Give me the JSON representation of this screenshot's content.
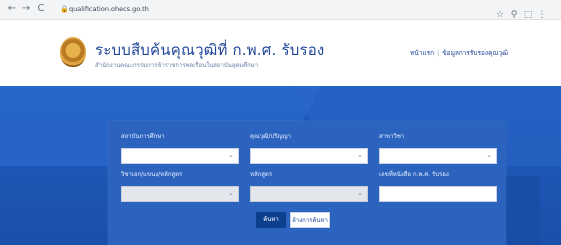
{
  "browser": {
    "back_icon": "←",
    "forward_icon": "→",
    "reload_icon": "C",
    "url": "qualification.ohecs.go.th",
    "toolbar_icons": [
      "star-icon",
      "search-icon",
      "extension-icon",
      "menu-icon"
    ]
  },
  "header": {
    "title": "ระบบสืบค้นคุณวุฒิที่ ก.พ.ศ. รับรอง",
    "subtitle": "สำนักงานคณะกรรมการข้าราชการพลเรือนในสถาบันอุดมศึกษา",
    "links": [
      "หน้าแรก",
      "ข้อมูลการรับรองคุณวุฒิ"
    ]
  },
  "search_form": {
    "fields": [
      {
        "label": "สถาบันการศึกษา",
        "type": "select",
        "disabled": false
      },
      {
        "label": "คุณวุฒิ/ปริญญา",
        "type": "select",
        "disabled": false
      },
      {
        "label": "สาขาวิชา",
        "type": "select",
        "disabled": false
      },
      {
        "label": "วิชาเอก/แขนง/หลักสูตร",
        "type": "select",
        "disabled": true
      },
      {
        "label": "หลักสูตร",
        "type": "select",
        "disabled": true
      },
      {
        "label": "เลขที่หนังสือ ก.พ.ศ. รับรอง",
        "type": "input",
        "disabled": false
      }
    ],
    "search_label": "ค้นหา",
    "reset_label": "ล้างการค้นหา"
  },
  "colors": {
    "brand_blue": "#21479a",
    "hero_blue": "#1f5cc0",
    "panel_blue": "#2b63bf",
    "button_dark": "#0d3f8f"
  }
}
